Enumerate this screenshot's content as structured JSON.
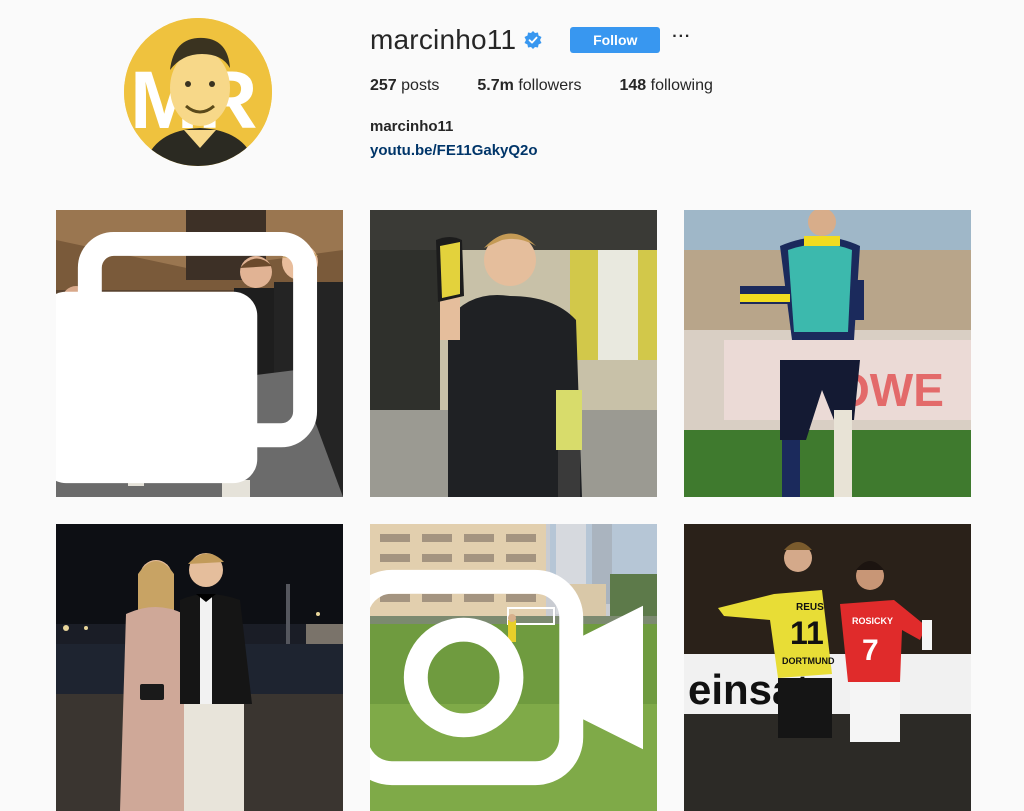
{
  "profile": {
    "username": "marcinho11",
    "verified": true,
    "follow_label": "Follow",
    "more_label": "···",
    "full_name": "marcinho11",
    "bio_link": "youtu.be/FE11GakyQ2o",
    "avatar_letters": "MR"
  },
  "stats": {
    "posts_count": "257",
    "posts_label": "posts",
    "followers_count": "5.7m",
    "followers_label": "followers",
    "following_count": "148",
    "following_label": "following"
  },
  "posts": [
    {
      "subject": "bar-beer-tap",
      "badge": "multi-post"
    },
    {
      "subject": "player-holding-boot",
      "badge": ""
    },
    {
      "subject": "training-bib",
      "badge": ""
    },
    {
      "subject": "couple-at-night",
      "badge": ""
    },
    {
      "subject": "football-pitch-buildings",
      "badge": "video"
    },
    {
      "subject": "match-players",
      "badge": ""
    }
  ],
  "photo_text": {
    "billboard": "OWE",
    "shirt_name_left": "REUS",
    "shirt_number_left": "11",
    "shirt_sponsor_left": "DORTMUND",
    "shirt_name_right": "ROSICKY",
    "shirt_number_right": "7",
    "ad_board": "einsatz"
  },
  "colors": {
    "accent": "#3897f0",
    "link": "#003569",
    "text": "#262626",
    "background": "#fafafa",
    "bvb_yellow": "#f6e30a"
  }
}
